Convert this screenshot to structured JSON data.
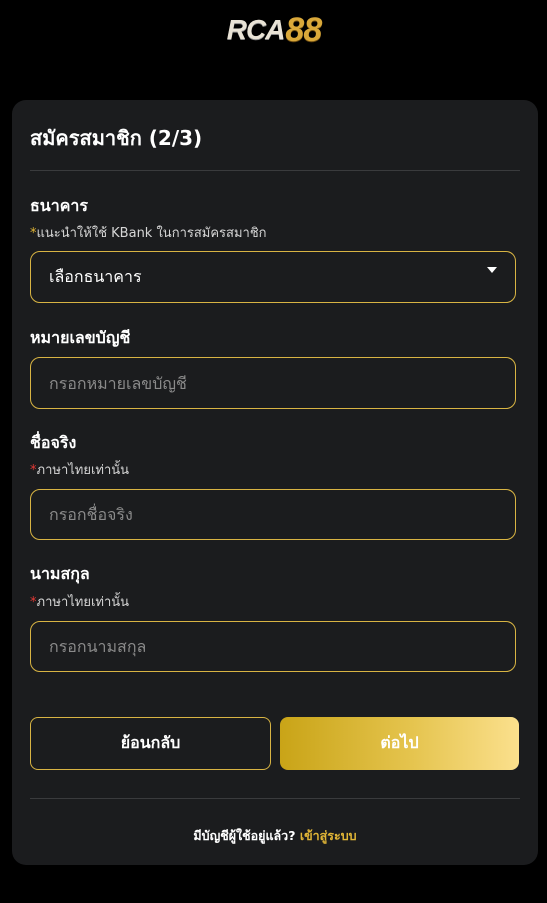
{
  "logo": {
    "text_rca": "RCA",
    "text_num": "88"
  },
  "form": {
    "title": "สมัครสมาชิก (2/3)",
    "bank": {
      "label": "ธนาคาร",
      "hint_star": "*",
      "hint": "แนะนำให้ใช้ KBank ในการสมัครสมาชิก",
      "selected": "เลือกธนาคาร"
    },
    "account": {
      "label": "หมายเลขบัญชี",
      "placeholder": "กรอกหมายเลขบัญชี"
    },
    "firstname": {
      "label": "ชื่อจริง",
      "hint_star": "*",
      "hint": "ภาษาไทยเท่านั้น",
      "placeholder": "กรอกชื่อจริง"
    },
    "lastname": {
      "label": "นามสกุล",
      "hint_star": "*",
      "hint": "ภาษาไทยเท่านั้น",
      "placeholder": "กรอกนามสกุล"
    },
    "back_label": "ย้อนกลับ",
    "next_label": "ต่อไป"
  },
  "footer": {
    "question": "มีบัญชีผู้ใช้อยู่แล้ว?",
    "login_link": "เข้าสู่ระบบ"
  },
  "colors": {
    "accent": "#d8b443",
    "background": "#000000",
    "card": "#1b1c1e"
  }
}
